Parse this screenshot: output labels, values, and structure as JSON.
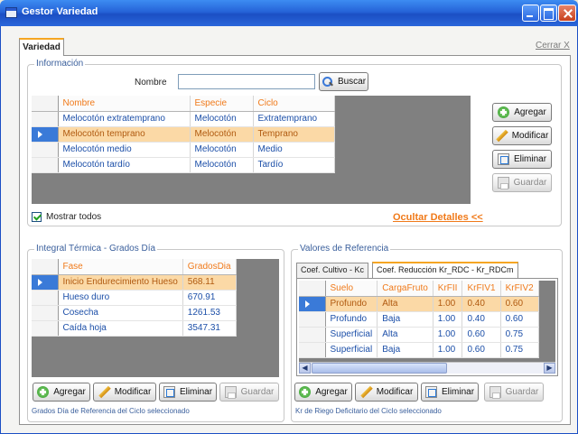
{
  "window": {
    "title": "Gestor Variedad"
  },
  "tab": {
    "label": "Variedad",
    "close_link": "Cerrar X"
  },
  "info": {
    "group_title": "Información",
    "nombre_label": "Nombre",
    "nombre_value": "",
    "search_button": "Buscar",
    "columns": [
      "Nombre",
      "Especie",
      "Ciclo"
    ],
    "rows": [
      [
        "Melocotón extratemprano",
        "Melocotón",
        "Extratemprano"
      ],
      [
        "Melocotón temprano",
        "Melocotón",
        "Temprano"
      ],
      [
        "Melocotón medio",
        "Melocotón",
        "Medio"
      ],
      [
        "Melocotón tardío",
        "Melocotón",
        "Tardío"
      ]
    ],
    "selected_row": 1,
    "buttons": {
      "add": "Agregar",
      "edit": "Modificar",
      "delete": "Eliminar",
      "save": "Guardar"
    },
    "show_all_label": "Mostrar todos",
    "show_all_checked": true,
    "hide_details_link": "Ocultar Detalles <<"
  },
  "thermal": {
    "group_title": "Integral Térmica - Grados Día",
    "columns": [
      "Fase",
      "GradosDia"
    ],
    "rows": [
      [
        "Inicio Endurecimiento Hueso",
        "568.11"
      ],
      [
        "Hueso duro",
        "670.91"
      ],
      [
        "Cosecha",
        "1261.53"
      ],
      [
        "Caída hoja",
        "3547.31"
      ]
    ],
    "selected_row": 0,
    "buttons": {
      "add": "Agregar",
      "edit": "Modificar",
      "delete": "Eliminar",
      "save": "Guardar"
    },
    "footnote": "Grados Día de Referencia del Ciclo seleccionado"
  },
  "reference": {
    "group_title": "Valores de Referencia",
    "tabs": [
      "Coef. Cultivo - Kc",
      "Coef. Reducción Kr_RDC - Kr_RDCm"
    ],
    "active_tab": 1,
    "columns": [
      "Suelo",
      "CargaFruto",
      "KrFII",
      "KrFIV1",
      "KrFIV2"
    ],
    "rows": [
      [
        "Profundo",
        "Alta",
        "1.00",
        "0.40",
        "0.60"
      ],
      [
        "Profundo",
        "Baja",
        "1.00",
        "0.40",
        "0.60"
      ],
      [
        "Superficial",
        "Alta",
        "1.00",
        "0.60",
        "0.75"
      ],
      [
        "Superficial",
        "Baja",
        "1.00",
        "0.60",
        "0.75"
      ]
    ],
    "selected_row": 0,
    "buttons": {
      "add": "Agregar",
      "edit": "Modificar",
      "delete": "Eliminar",
      "save": "Guardar"
    },
    "footnote": "Kr de Riego Deficitario del Ciclo seleccionado"
  }
}
